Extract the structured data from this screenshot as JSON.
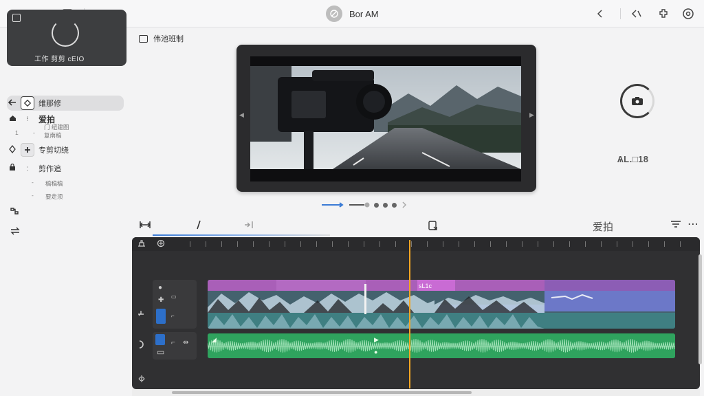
{
  "window": {
    "title": "Bor AM"
  },
  "titlebar": {
    "sidebar_toggle_icon": "sidebar-toggle-icon",
    "forward_icon": "chevron-right-icon",
    "right_icons": [
      "share-icon",
      "collaborate-icon",
      "extensions-icon",
      "settings-icon"
    ]
  },
  "sidebar": {
    "card_label": "工作 剪剪 cEIO",
    "items": [
      {
        "label": "维那修",
        "icon": "back-arrow-icon",
        "badge": "diamond-icon",
        "active": true
      },
      {
        "label": "爱拍",
        "icon": "home-icon",
        "badge": "dot-icon",
        "sub": "门    纽建图"
      },
      {
        "label": "",
        "icon": "",
        "badge": "",
        "sub": "复南稿"
      },
      {
        "label": "专剪切绕",
        "icon": "diamond-outline-icon",
        "badge": "plus-icon"
      },
      {
        "label": "剪作追",
        "icon": "lock-icon",
        "badge": "dot-icon"
      },
      {
        "label": "",
        "icon": "",
        "badge": "",
        "sub": "稿稿稿"
      },
      {
        "label": "",
        "icon": "",
        "badge": "",
        "sub": "要走须"
      }
    ],
    "bottom_icons": [
      "split-icon",
      "swap-icon"
    ]
  },
  "preview": {
    "label": "伟池班制",
    "record_text": "ѦL.□18"
  },
  "toolbar": {
    "title": "爱拍",
    "icons": [
      "trim-icon",
      "blade-icon",
      "transition-icon",
      "export-icon",
      "filter-icon",
      "more-icon"
    ]
  },
  "timeline": {
    "playhead_time": "",
    "clip_label": "sL1c",
    "tracks": [
      "video",
      "audio"
    ]
  },
  "colors": {
    "accent": "#3a7bd5",
    "playhead": "#f5a623",
    "video_clip": "#44626e",
    "title_clip": "#b36ac2",
    "audio_clip": "#2fa35e"
  }
}
